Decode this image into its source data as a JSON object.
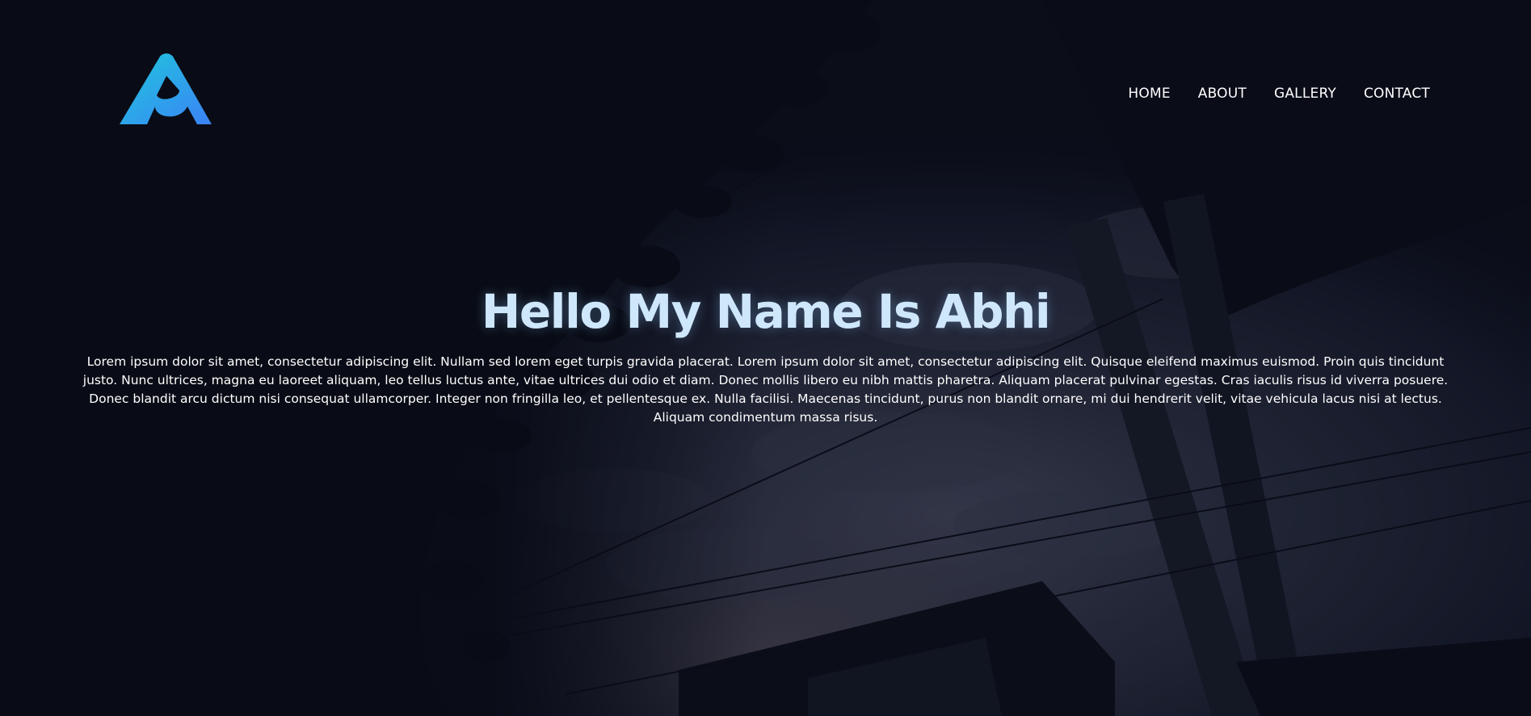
{
  "logo": {
    "icon": "letter-a-logo-icon",
    "colors": [
      "#1fc8dc",
      "#3b82f6"
    ]
  },
  "nav": {
    "items": [
      {
        "label": "HOME"
      },
      {
        "label": "ABOUT"
      },
      {
        "label": "GALLERY"
      },
      {
        "label": "CONTACT"
      }
    ]
  },
  "hero": {
    "title": "Hello My Name Is Abhi",
    "text": "Lorem ipsum dolor sit amet, consectetur adipiscing elit. Nullam sed lorem eget turpis gravida placerat. Lorem ipsum dolor sit amet, consectetur adipiscing elit. Quisque eleifend maximus euismod. Proin quis tincidunt justo. Nunc ultrices, magna eu laoreet aliquam, leo tellus luctus ante, vitae ultrices dui odio et diam. Donec mollis libero eu nibh mattis pharetra. Aliquam placerat pulvinar egestas. Cras iaculis risus id viverra posuere. Donec blandit arcu dictum nisi consequat ullamcorper. Integer non fringilla leo, et pellentesque ex. Nulla facilisi. Maecenas tincidunt, purus non blandit ornare, mi dui hendrerit velit, vitae vehicula lacus nisi at lectus. Aliquam condimentum massa risus."
  },
  "colors": {
    "background": "#0b0d1a",
    "title": "#cfe7fb",
    "text": "#ffffff"
  }
}
